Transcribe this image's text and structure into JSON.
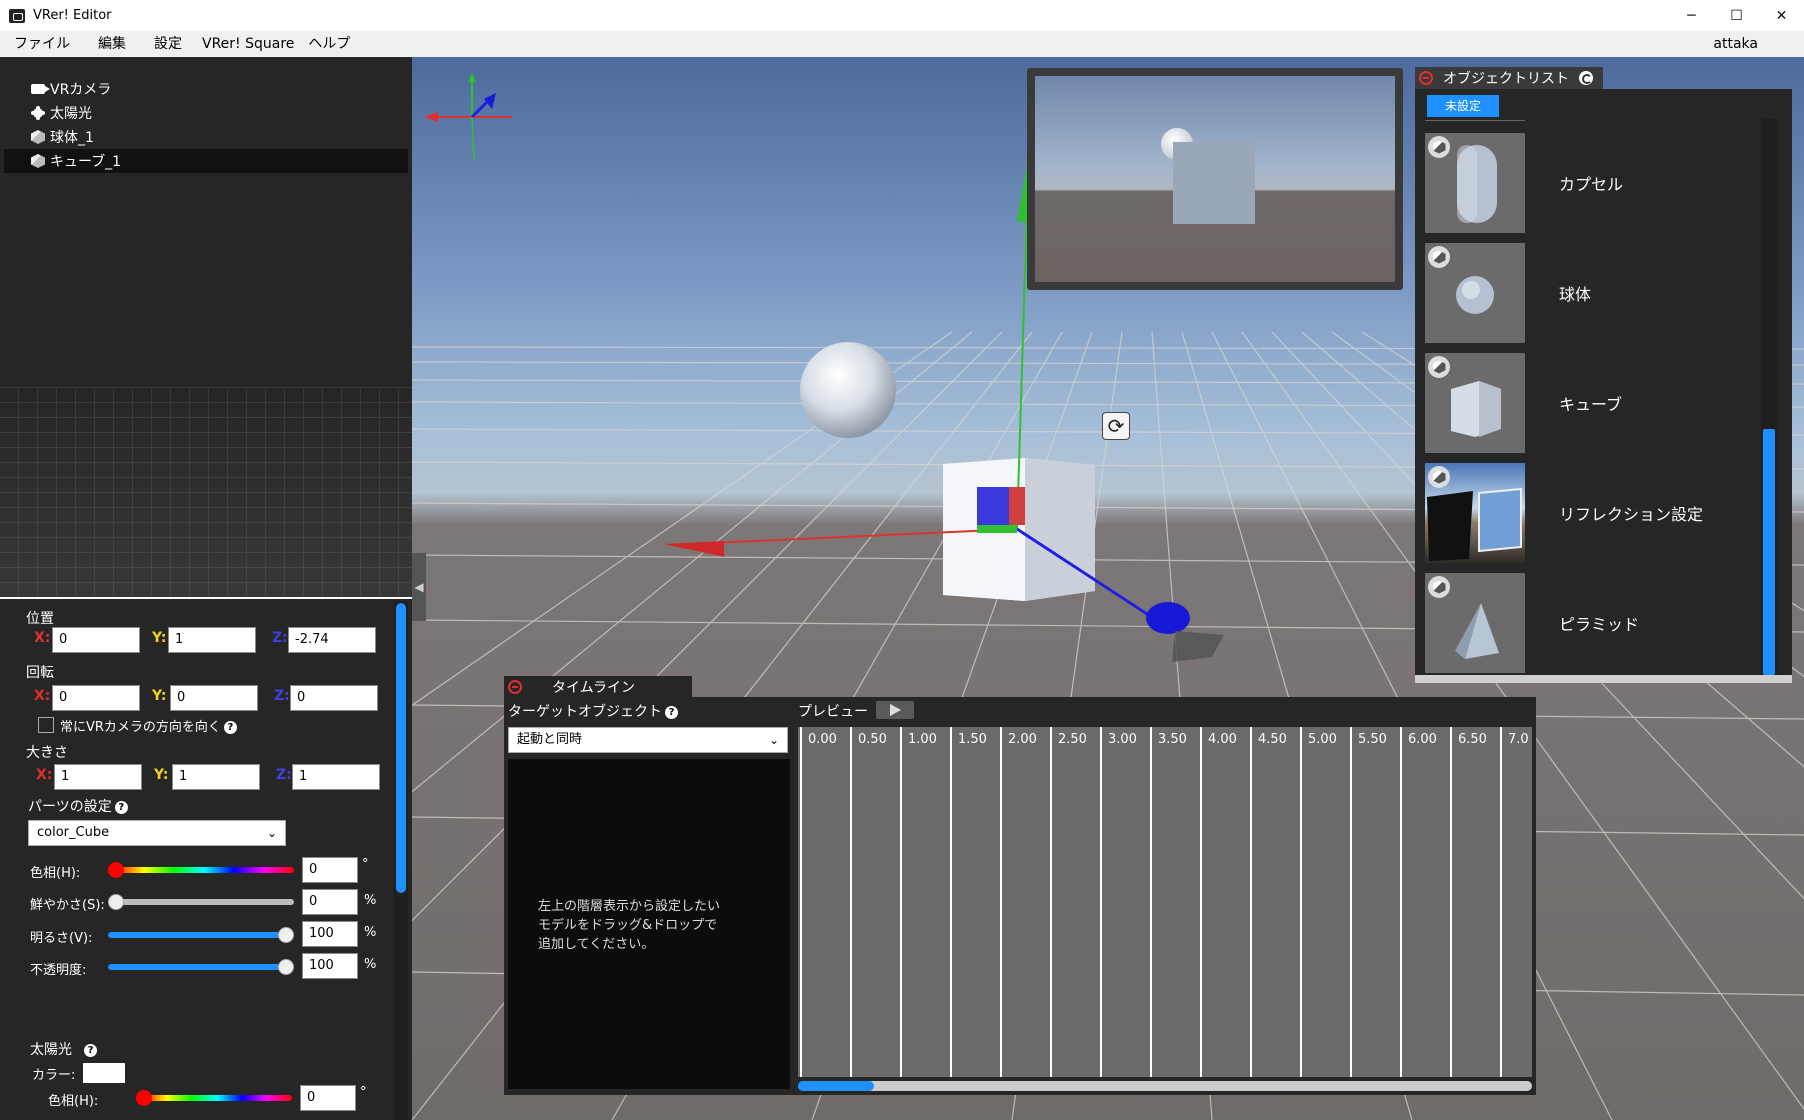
{
  "window": {
    "title": "VRer! Editor",
    "minimize": "─",
    "maximize": "☐",
    "close": "✕"
  },
  "menu": {
    "items": [
      "ファイル",
      "編集",
      "設定",
      "VRer! Square",
      "ヘルプ"
    ],
    "user": "attaka"
  },
  "hierarchy": {
    "items": [
      {
        "label": "VRカメラ",
        "icon": "camera-icon"
      },
      {
        "label": "太陽光",
        "icon": "sun-icon"
      },
      {
        "label": "球体_1",
        "icon": "cube-icon"
      },
      {
        "label": "キューブ_1",
        "icon": "cube-icon",
        "selected": true
      }
    ]
  },
  "inspector": {
    "position_label": "位置",
    "position": {
      "x": "0",
      "y": "1",
      "z": "-2.74"
    },
    "rotation_label": "回転",
    "rotation": {
      "x": "0",
      "y": "0",
      "z": "0"
    },
    "face_camera_label": "常にVRカメラの方向を向く",
    "face_camera_checked": false,
    "scale_label": "大きさ",
    "scale": {
      "x": "1",
      "y": "1",
      "z": "1"
    },
    "axis_x": "X:",
    "axis_y": "Y:",
    "axis_z": "Z:",
    "parts_label": "パーツの設定",
    "parts_value": "color_Cube",
    "hue_label": "色相(H):",
    "hue_value": "0",
    "hue_unit": "°",
    "saturation_label": "鮮やかさ(S):",
    "saturation_value": "0",
    "saturation_unit": "%",
    "brightness_label": "明るさ(V):",
    "brightness_value": "100",
    "brightness_unit": "%",
    "opacity_label": "不透明度:",
    "opacity_value": "100",
    "opacity_unit": "%",
    "sun_label": "太陽光",
    "color_label": "カラー:",
    "sun_hue_label": "色相(H):",
    "sun_hue_value": "0",
    "sun_hue_unit": "°",
    "help": "?"
  },
  "scene": {
    "rotate_icon": "⟳"
  },
  "object_list": {
    "title": "オブジェクトリスト",
    "filter": "未設定",
    "items": [
      {
        "label": "カプセル",
        "icon": "capsule"
      },
      {
        "label": "球体",
        "icon": "sphere"
      },
      {
        "label": "キューブ",
        "icon": "cube"
      },
      {
        "label": "リフレクション設定",
        "icon": "reflection"
      },
      {
        "label": "ピラミッド",
        "icon": "pyramid"
      }
    ]
  },
  "timeline": {
    "title": "タイムライン",
    "target_label": "ターゲットオブジェクト",
    "help": "?",
    "trigger_value": "起動と同時",
    "hint": "左上の階層表示から設定したい\nモデルをドラッグ&ドロップで\n追加してください。",
    "preview_label": "プレビュー",
    "ticks": [
      "0.00",
      "0.50",
      "1.00",
      "1.50",
      "2.00",
      "2.50",
      "3.00",
      "3.50",
      "4.00",
      "4.50",
      "5.00",
      "5.50",
      "6.00",
      "6.50",
      "7.0"
    ]
  },
  "colors": {
    "accent": "#1e90ff",
    "axis_x": "#e03030",
    "axis_y": "#30c030",
    "axis_z": "#2020e0",
    "panel": "#262626"
  }
}
